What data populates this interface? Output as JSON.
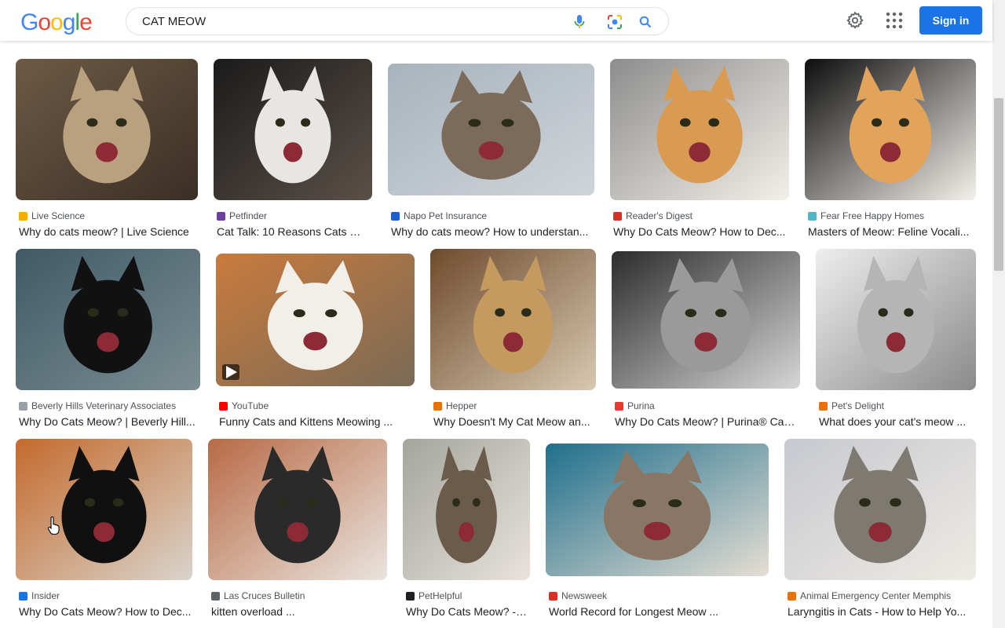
{
  "header": {
    "logo_text": "Google",
    "search_value": "CAT MEOW",
    "signin_label": "Sign in",
    "icons": [
      "microphone-icon",
      "camera-lens-icon",
      "search-icon",
      "gear-icon",
      "apps-grid-icon"
    ]
  },
  "results": [
    {
      "source": "Live Science",
      "title": "Why do cats meow? | Live Science",
      "favicon_color": "#f9ab00"
    },
    {
      "source": "Petfinder",
      "title": "Cat Talk: 10 Reasons Cats M...",
      "favicon_color": "#6b3fa0"
    },
    {
      "source": "Napo Pet Insurance",
      "title": "Why do cats meow? How to understan...",
      "favicon_color": "#1a5fd0"
    },
    {
      "source": "Reader's Digest",
      "title": "Why Do Cats Meow? How to Dec...",
      "favicon_color": "#d93025"
    },
    {
      "source": "Fear Free Happy Homes",
      "title": "Masters of Meow: Feline Vocali...",
      "favicon_color": "#4fb7c9"
    },
    {
      "source": "Beverly Hills Veterinary Associates",
      "title": "Why Do Cats Meow? | Beverly Hill...",
      "favicon_color": "#9aa0a6"
    },
    {
      "source": "YouTube",
      "title": "Funny Cats and Kittens Meowing ...",
      "favicon_color": "#ff0000"
    },
    {
      "source": "Hepper",
      "title": "Why Doesn't My Cat Meow an...",
      "favicon_color": "#e8710a"
    },
    {
      "source": "Purina",
      "title": "Why Do Cats Meow? | Purina® Can...",
      "favicon_color": "#e53935"
    },
    {
      "source": "Pet's Delight",
      "title": "What does your cat's meow ...",
      "favicon_color": "#e8710a"
    },
    {
      "source": "Insider",
      "title": "Why Do Cats Meow? How to Dec...",
      "favicon_color": "#1a73e8"
    },
    {
      "source": "Las Cruces Bulletin",
      "title": "kitten overload ...",
      "favicon_color": "#5f6368"
    },
    {
      "source": "PetHelpful",
      "title": "Why Do Cats Meow? - ...",
      "favicon_color": "#202124"
    },
    {
      "source": "Newsweek",
      "title": "World Record for Longest Meow ...",
      "favicon_color": "#d93025"
    },
    {
      "source": "Animal Emergency Center Memphis",
      "title": "Laryngitis in Cats - How to Help Yo...",
      "favicon_color": "#e8710a"
    }
  ]
}
